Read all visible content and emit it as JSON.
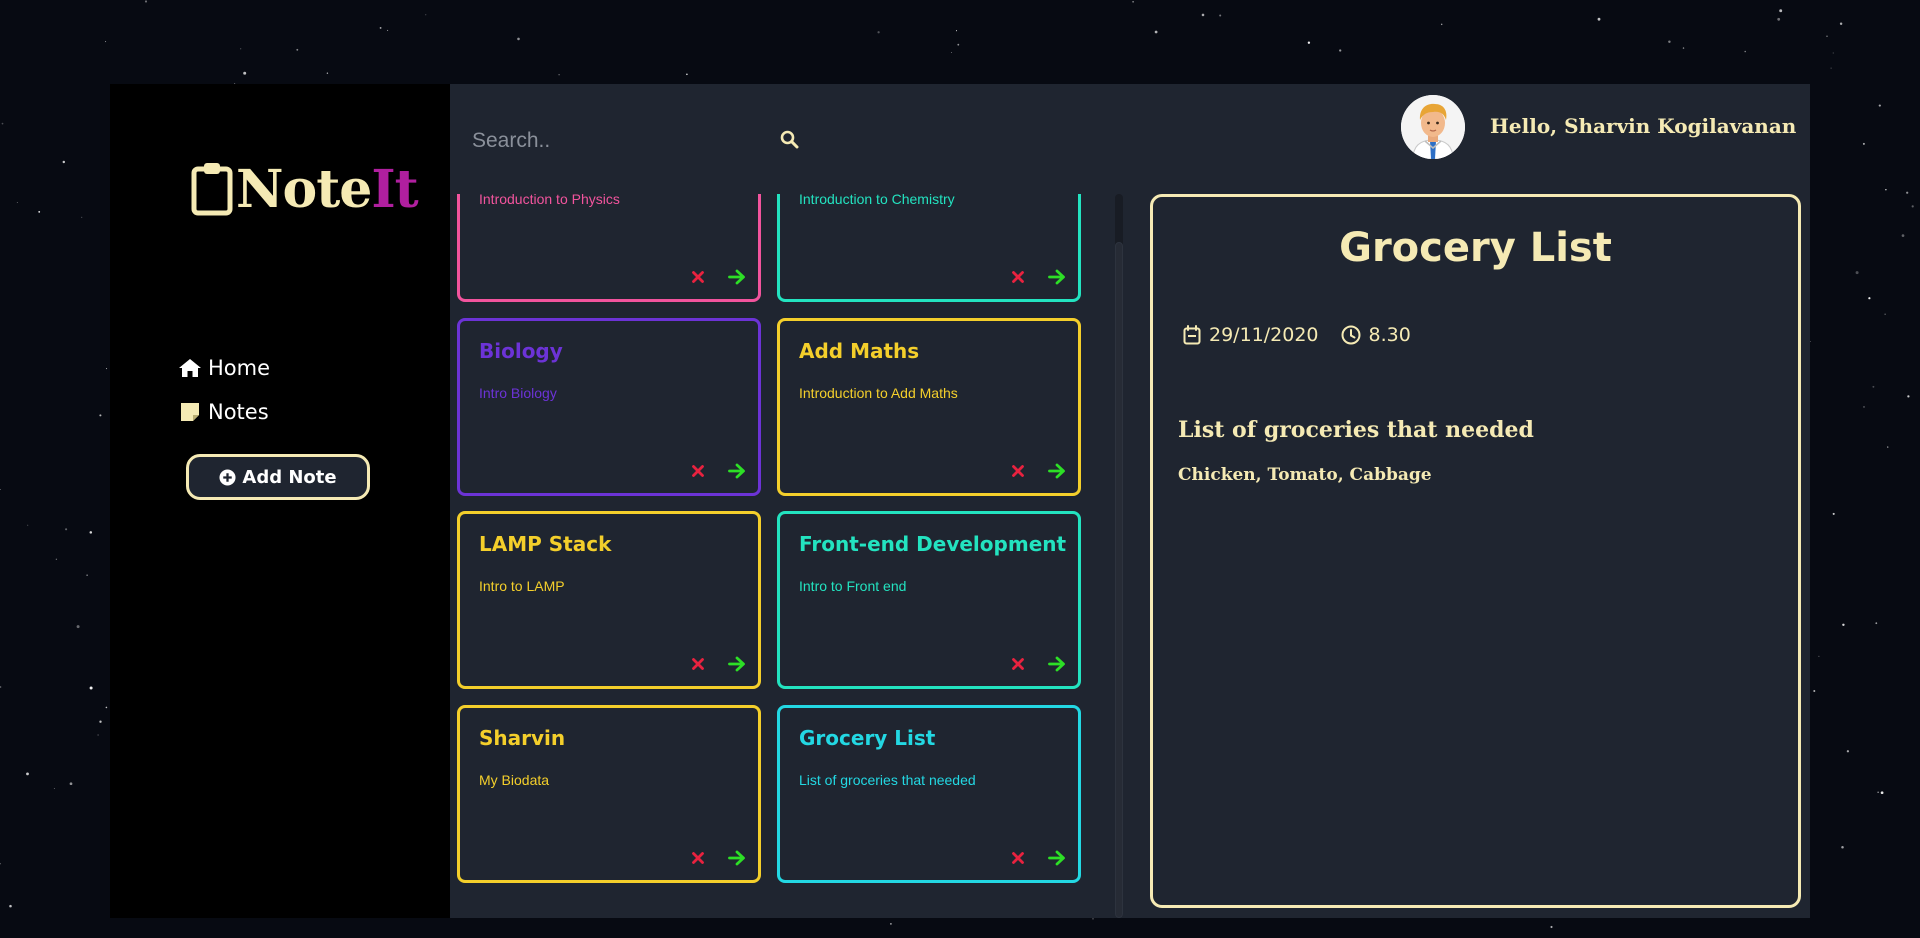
{
  "app": {
    "logo_note": "Note",
    "logo_it": "It",
    "colors": {
      "accent": "#f5eab4",
      "brand_it": "#b01f9f",
      "panel": "#1f2530",
      "sidebar": "#000000"
    }
  },
  "sidebar": {
    "nav": [
      {
        "label": "Home",
        "icon": "home-icon"
      },
      {
        "label": "Notes",
        "icon": "sticky-note-icon"
      }
    ],
    "add_note_label": "Add Note"
  },
  "header": {
    "search_placeholder": "Search..",
    "greeting": "Hello, Sharvin Kogilavanan"
  },
  "notes": [
    {
      "title": "",
      "desc": "Introduction to Physics",
      "color": "#f2549d"
    },
    {
      "title": "",
      "desc": "Introduction to Chemistry",
      "color": "#23e3c0"
    },
    {
      "title": "Biology",
      "desc": "Intro Biology",
      "color": "#6c33d6"
    },
    {
      "title": "Add Maths",
      "desc": "Introduction to Add Maths",
      "color": "#f4cf2b"
    },
    {
      "title": "LAMP Stack",
      "desc": "Intro to LAMP",
      "color": "#f4cf2b"
    },
    {
      "title": "Front-end Development",
      "desc": "Intro to Front end",
      "color": "#23e3c0"
    },
    {
      "title": "Sharvin",
      "desc": "My Biodata",
      "color": "#f4cf2b"
    },
    {
      "title": "Grocery List",
      "desc": "List of groceries that needed",
      "color": "#23d8e3"
    }
  ],
  "detail": {
    "title": "Grocery List",
    "date": "29/11/2020",
    "time": "8.30",
    "subtitle": "List of groceries that needed",
    "body": "Chicken, Tomato, Cabbage"
  }
}
